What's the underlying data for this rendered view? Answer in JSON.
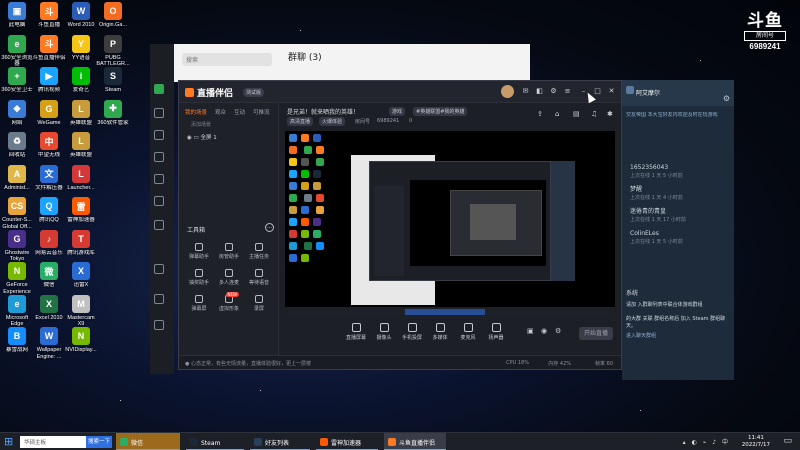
{
  "desktop_icons": [
    {
      "label": "此电脑",
      "color": "#3a7bd5",
      "glyph": "▣"
    },
    {
      "label": "斗鱼直播",
      "color": "#ff7a21",
      "glyph": "斗"
    },
    {
      "label": "Word 2010",
      "color": "#2b5cb8",
      "glyph": "W"
    },
    {
      "label": "Origin.Ga...",
      "color": "#f36c21",
      "glyph": "O"
    },
    {
      "label": "360安全浏览器",
      "color": "#2fa84f",
      "glyph": "e"
    },
    {
      "label": "斗鱼直播伴侣",
      "color": "#ff7a21",
      "glyph": "斗"
    },
    {
      "label": "YY语音",
      "color": "#f5c518",
      "glyph": "Y"
    },
    {
      "label": "PUBG BATTLEGR...",
      "color": "#3d3d3d",
      "glyph": "P"
    },
    {
      "label": "360安全卫士",
      "color": "#2fa84f",
      "glyph": "+"
    },
    {
      "label": "腾讯视频",
      "color": "#1aa3ff",
      "glyph": "▶"
    },
    {
      "label": "爱奇艺",
      "color": "#00be06",
      "glyph": "i"
    },
    {
      "label": "Steam",
      "color": "#1b2838",
      "glyph": "S"
    },
    {
      "label": "网络",
      "color": "#3a7bd5",
      "glyph": "◈"
    },
    {
      "label": "WeGame",
      "color": "#d4a017",
      "glyph": "G"
    },
    {
      "label": "英雄联盟",
      "color": "#c89b3c",
      "glyph": "L"
    },
    {
      "label": "360软件管家",
      "color": "#2fa84f",
      "glyph": "✚"
    },
    {
      "label": "回收站",
      "color": "#6b7b8c",
      "glyph": "♻"
    },
    {
      "label": "中望无线",
      "color": "#e8492e",
      "glyph": "中"
    },
    {
      "label": "英雄联盟",
      "color": "#c89b3c",
      "glyph": "L"
    },
    {
      "label": "",
      "color": "#000000",
      "glyph": ""
    },
    {
      "label": "Administ...",
      "color": "#e0b84a",
      "glyph": "A"
    },
    {
      "label": "文件解压器",
      "color": "#2b6cd4",
      "glyph": "文"
    },
    {
      "label": "Launcher...",
      "color": "#d43838",
      "glyph": "L"
    },
    {
      "label": "",
      "color": "#000000",
      "glyph": ""
    },
    {
      "label": "Counter-S... Global Off...",
      "color": "#e8a33a",
      "glyph": "CS"
    },
    {
      "label": "腾讯QQ",
      "color": "#1aa3ff",
      "glyph": "Q"
    },
    {
      "label": "雷神加速器",
      "color": "#ff5a00",
      "glyph": "雷"
    },
    {
      "label": "",
      "color": "#000000",
      "glyph": ""
    },
    {
      "label": "Ghostwire Tokyo",
      "color": "#4a2f8a",
      "glyph": "G"
    },
    {
      "label": "网易云音乐",
      "color": "#d43c33",
      "glyph": "♪"
    },
    {
      "label": "腾讯游戏库",
      "color": "#d43c33",
      "glyph": "T"
    },
    {
      "label": "",
      "color": "#000000",
      "glyph": ""
    },
    {
      "label": "GeForce Experience",
      "color": "#76b900",
      "glyph": "N"
    },
    {
      "label": "微信",
      "color": "#2aae67",
      "glyph": "微"
    },
    {
      "label": "迅雷X",
      "color": "#2b6cd4",
      "glyph": "X"
    },
    {
      "label": "",
      "color": "#000000",
      "glyph": ""
    },
    {
      "label": "Microsoft Edge",
      "color": "#1e9ad6",
      "glyph": "e"
    },
    {
      "label": "Excel 2010",
      "color": "#217346",
      "glyph": "X"
    },
    {
      "label": "Mastercam X9",
      "color": "#c0c0c0",
      "glyph": "M"
    },
    {
      "label": "",
      "color": "#000000",
      "glyph": ""
    },
    {
      "label": "暴雪战网",
      "color": "#148eff",
      "glyph": "B"
    },
    {
      "label": "Wallpaper Engine: ...",
      "color": "#2b6cd4",
      "glyph": "W"
    },
    {
      "label": "NVIDisplay...",
      "color": "#76b900",
      "glyph": "N"
    }
  ],
  "white_window": {
    "search_placeholder": "搜索",
    "title": "群聊 (3)"
  },
  "right_chat": {
    "header": "阿艾摩尔",
    "notice": "交友帝国 本大宝好友内欢迎及时在玩游戏",
    "items": [
      {
        "title": "1652356043",
        "sub": "上次在线 1 天 5 小时前"
      },
      {
        "title": "梦醒",
        "sub": "上次在线 1 天 4 小时前"
      },
      {
        "title": "迷倦青的青皇",
        "sub": "上次在线 1 天 17 小时前"
      },
      {
        "title": "ColinELes",
        "sub": "上次在线 1 天 5 小时前"
      }
    ],
    "section": "系统",
    "footer1": "请加 入群聊列表中联合体游戏群组",
    "footer2": "的大群 关联 群组名称后 加入 Steam 群组聊天。",
    "footer3": "进入聊天群组"
  },
  "app": {
    "logo": "直播伴侣",
    "badge": "测试版",
    "left_tabs": [
      "我的场景",
      "观众",
      "互动",
      "可推流"
    ],
    "add_scene": "添加场景",
    "scene": "全屏 1",
    "tools_title": "工具箱",
    "tools": [
      "弹幕助手",
      "房管助手",
      "主播任务",
      "抽奖助手",
      "多人连麦",
      "等待语音",
      "弹幕屏",
      "虚拟形象",
      "录屏"
    ],
    "tool_badge": "NEW",
    "info": {
      "title": "是兄弟！就来晒我的英雄！",
      "tag1": "游戏",
      "tag2": "#英雄联盟#我的英雄",
      "tag3": "高清直播",
      "tag4": "火爆体验",
      "room_label": "房间号",
      "room_id": "6989241",
      "likes": "0"
    },
    "bottom_buttons": [
      "直播屏幕",
      "摄像头",
      "手机投屏",
      "多媒体",
      "麦克风",
      "扬声器"
    ],
    "start_label": "开始直播",
    "status": "● 心态正常，有些无情流量，直播体验很好，更上一层楼",
    "status_right1": "CPU 18%",
    "status_right2": "内存 42%",
    "status_right3": "帧率 60"
  },
  "taskbar": {
    "search_placeholder": "华硕主板",
    "search_button": "搜索一下",
    "apps": [
      {
        "label": "微信",
        "color": "#2aae67"
      },
      {
        "label": "Steam",
        "color": "#1b2838"
      },
      {
        "label": "好友列表",
        "color": "#2a3f5a"
      },
      {
        "label": "雷神加速器",
        "color": "#ff5a00"
      },
      {
        "label": "斗鱼直播伴侣",
        "color": "#ff7a21"
      }
    ],
    "time": "11:41",
    "date": "2022/7/17"
  },
  "watermark": {
    "brand": "斗鱼",
    "sub": "房间号",
    "room": "6989241"
  }
}
